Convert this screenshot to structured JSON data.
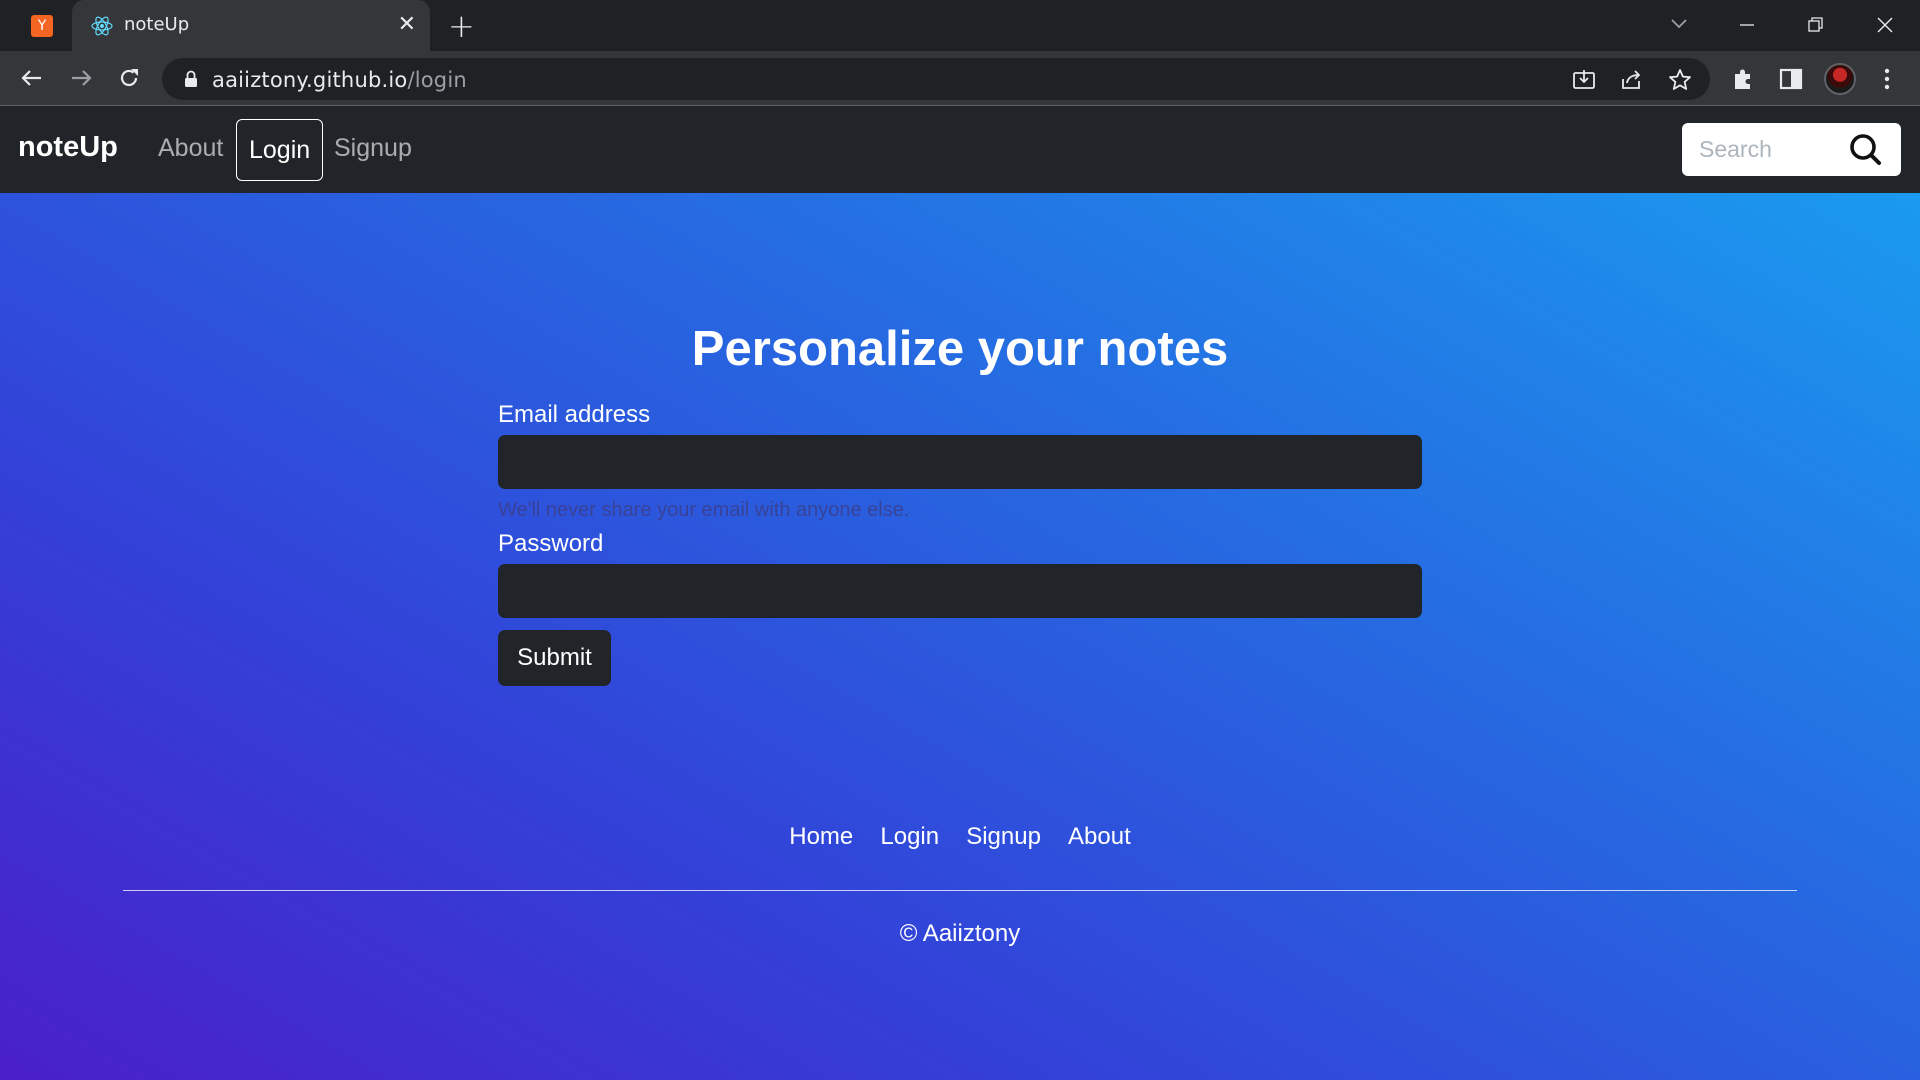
{
  "browser": {
    "pinned_tab_letter": "Y",
    "active_tab_title": "noteUp",
    "url_host": "aaiiztony.github.io",
    "url_path": "/login"
  },
  "navbar": {
    "brand": "noteUp",
    "links": [
      "About",
      "Login",
      "Signup"
    ],
    "active_link": "Login",
    "search_placeholder": "Search"
  },
  "main": {
    "heading": "Personalize your notes",
    "email_label": "Email address",
    "email_value": "",
    "email_help": "We'll never share your email with anyone else.",
    "password_label": "Password",
    "password_value": "",
    "submit_label": "Submit"
  },
  "footer": {
    "links": [
      "Home",
      "Login",
      "Signup",
      "About"
    ],
    "copyright": "© Aaiiztony"
  },
  "colors": {
    "navbar_bg": "#212529",
    "gradient_start": "#4a1fc9",
    "gradient_end": "#1a9aef"
  }
}
